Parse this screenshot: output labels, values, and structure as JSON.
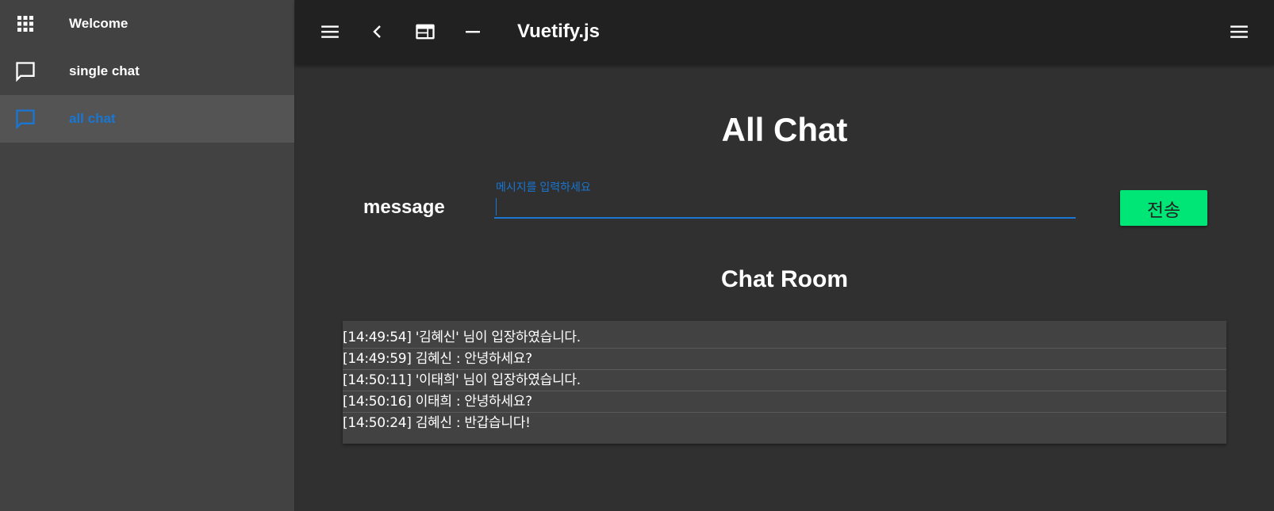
{
  "sidebar": {
    "items": [
      {
        "label": "Welcome",
        "icon": "apps-grid-icon"
      },
      {
        "label": "single chat",
        "icon": "chat-bubble-icon"
      },
      {
        "label": "all chat",
        "icon": "chat-bubble-icon",
        "active": true
      }
    ]
  },
  "toolbar": {
    "title": "Vuetify.js",
    "icons": [
      "menu-icon",
      "chevron-left-icon",
      "web-layout-icon",
      "minus-icon",
      "menu-icon"
    ]
  },
  "main": {
    "page_title": "All Chat",
    "message_label": "message",
    "input": {
      "hint": "메시지를 입력하세요",
      "value": ""
    },
    "send_label": "전송",
    "room_title": "Chat Room",
    "messages": [
      "[14:49:54] '김혜신' 님이 입장하였습니다.",
      "[14:49:59] 김혜신 : 안녕하세요?",
      "[14:50:11] '이태희' 님이 입장하였습니다.",
      "[14:50:16] 이태희 : 안녕하세요?",
      "[14:50:24] 김혜신 : 반갑습니다!"
    ]
  },
  "colors": {
    "accent": "#1976d2",
    "send_button": "#00e676",
    "toolbar_bg": "#212121",
    "sidebar_bg": "#424242",
    "page_bg": "#303030"
  }
}
